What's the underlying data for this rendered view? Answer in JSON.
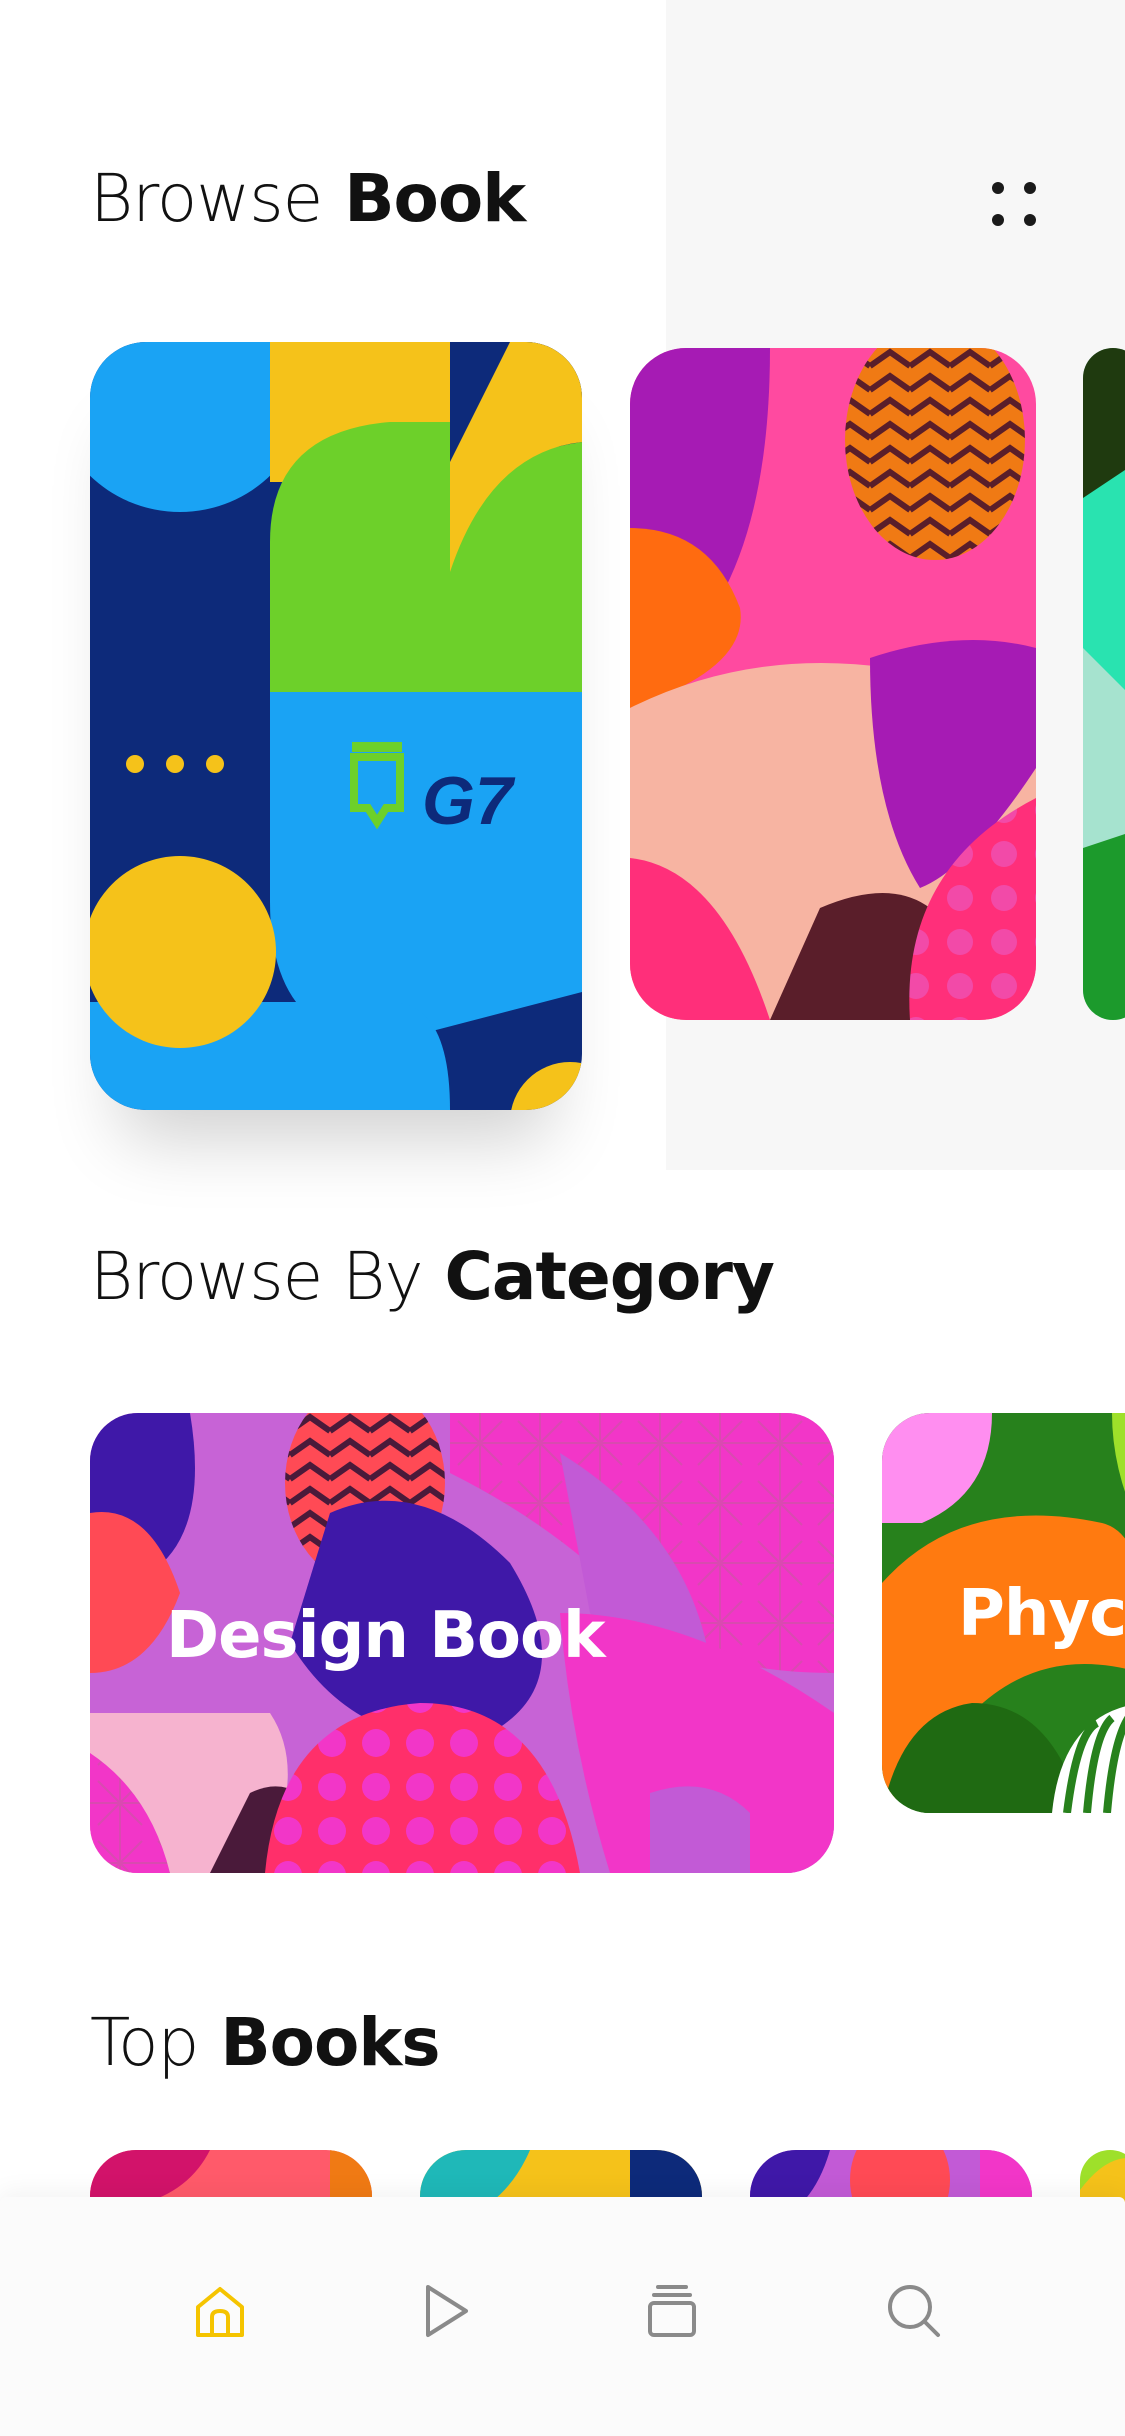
{
  "header": {
    "title_light": "Browse",
    "title_bold": "Book",
    "menu_icon": "grid-dots-icon"
  },
  "featured_books": [
    {
      "name": "G7",
      "palette": "blue-yellow-green"
    },
    {
      "name": "",
      "palette": "pink-orange-purple"
    },
    {
      "name": "",
      "palette": "green-teal"
    }
  ],
  "category_section": {
    "title_light": "Browse By",
    "title_bold": "Category",
    "items": [
      {
        "label": "Design Book"
      },
      {
        "label": "Phyc"
      }
    ]
  },
  "top_books_section": {
    "title_light": "Top",
    "title_bold": "Books"
  },
  "tabbar": {
    "active": "home",
    "active_color": "#F5C400",
    "inactive_color": "#8A8A8A",
    "tabs": [
      "home-icon",
      "play-icon",
      "library-icon",
      "search-icon"
    ]
  }
}
